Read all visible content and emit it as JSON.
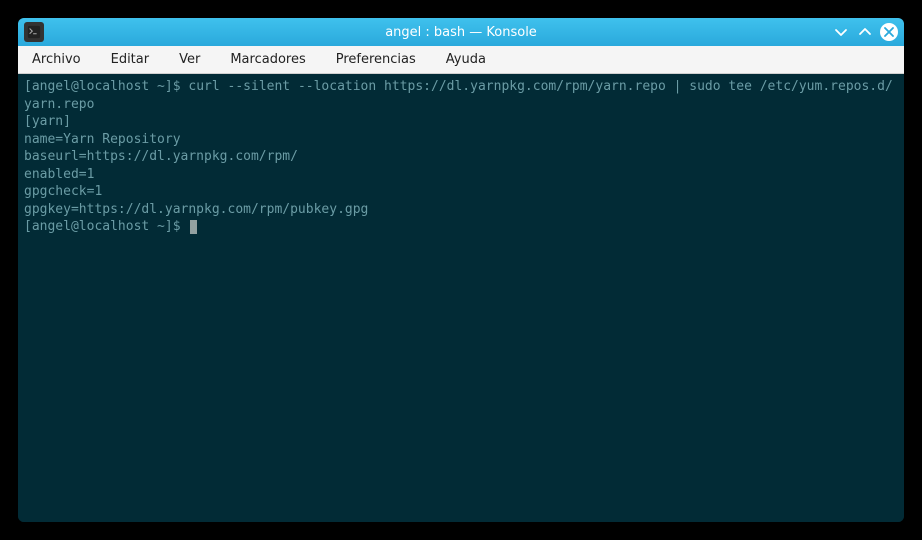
{
  "window": {
    "title": "angel : bash — Konsole"
  },
  "menubar": {
    "items": [
      "Archivo",
      "Editar",
      "Ver",
      "Marcadores",
      "Preferencias",
      "Ayuda"
    ]
  },
  "terminal": {
    "prompt1": "[angel@localhost ~]$ ",
    "command1": "curl --silent --location https://dl.yarnpkg.com/rpm/yarn.repo | sudo tee /etc/yum.repos.d/yarn.repo",
    "output_lines": [
      "[yarn]",
      "name=Yarn Repository",
      "baseurl=https://dl.yarnpkg.com/rpm/",
      "enabled=1",
      "gpgcheck=1",
      "gpgkey=https://dl.yarnpkg.com/rpm/pubkey.gpg"
    ],
    "prompt2": "[angel@localhost ~]$ "
  },
  "colors": {
    "titlebar": "#2aa9dc",
    "terminal_bg": "#022b36",
    "terminal_fg": "#6b9ca5"
  }
}
